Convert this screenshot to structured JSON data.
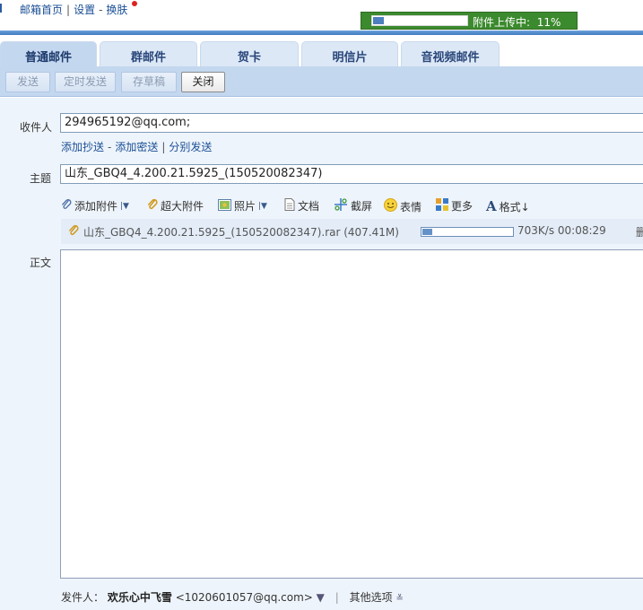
{
  "top_links": {
    "home": "邮箱首页",
    "settings": "设置",
    "dash": "-",
    "skin": "换肤"
  },
  "upload_status": {
    "label": "附件上传中:",
    "percent_text": "11%",
    "progress": 0.11
  },
  "tabs": [
    {
      "label": "普通邮件",
      "active": true
    },
    {
      "label": "群邮件",
      "active": false
    },
    {
      "label": "贺卡",
      "active": false
    },
    {
      "label": "明信片",
      "active": false
    },
    {
      "label": "音视频邮件",
      "active": false
    }
  ],
  "toolbar": {
    "send": "发送",
    "schedule": "定时发送",
    "draft": "存草稿",
    "close": "关闭"
  },
  "form": {
    "to_label": "收件人",
    "to_value": "294965192@qq.com;",
    "add_cc": "添加抄送",
    "add_bcc": "添加密送",
    "separate": "分别发送",
    "subject_label": "主题",
    "subject_value": "山东_GBQ4_4.200.21.5925_(150520082347)",
    "body_label": "正文"
  },
  "attach_toolbar": {
    "add_attachment": "添加附件",
    "large_attachment": "超大附件",
    "photo": "照片",
    "document": "文档",
    "screenshot": "截屏",
    "emoji": "表情",
    "more": "更多",
    "format": "格式↓"
  },
  "attachment": {
    "filename": "山东_GBQ4_4.200.21.5925_(150520082347).rar (407.41M)",
    "speed_time": "703K/s 00:08:29",
    "delete": "删",
    "progress": 0.11
  },
  "footer": {
    "sender_label": "发件人：",
    "sender_name": "欢乐心中飞雪",
    "sender_email": "<1020601057@qq.com>",
    "dropdown": "▼",
    "bar": "|",
    "other_options": "其他选项"
  },
  "colors": {
    "upload_bg": "#3c8a2e",
    "tab_bg": "#dce8f6",
    "toolbar_bg": "#c3d7ef",
    "link": "#1a4f95"
  }
}
